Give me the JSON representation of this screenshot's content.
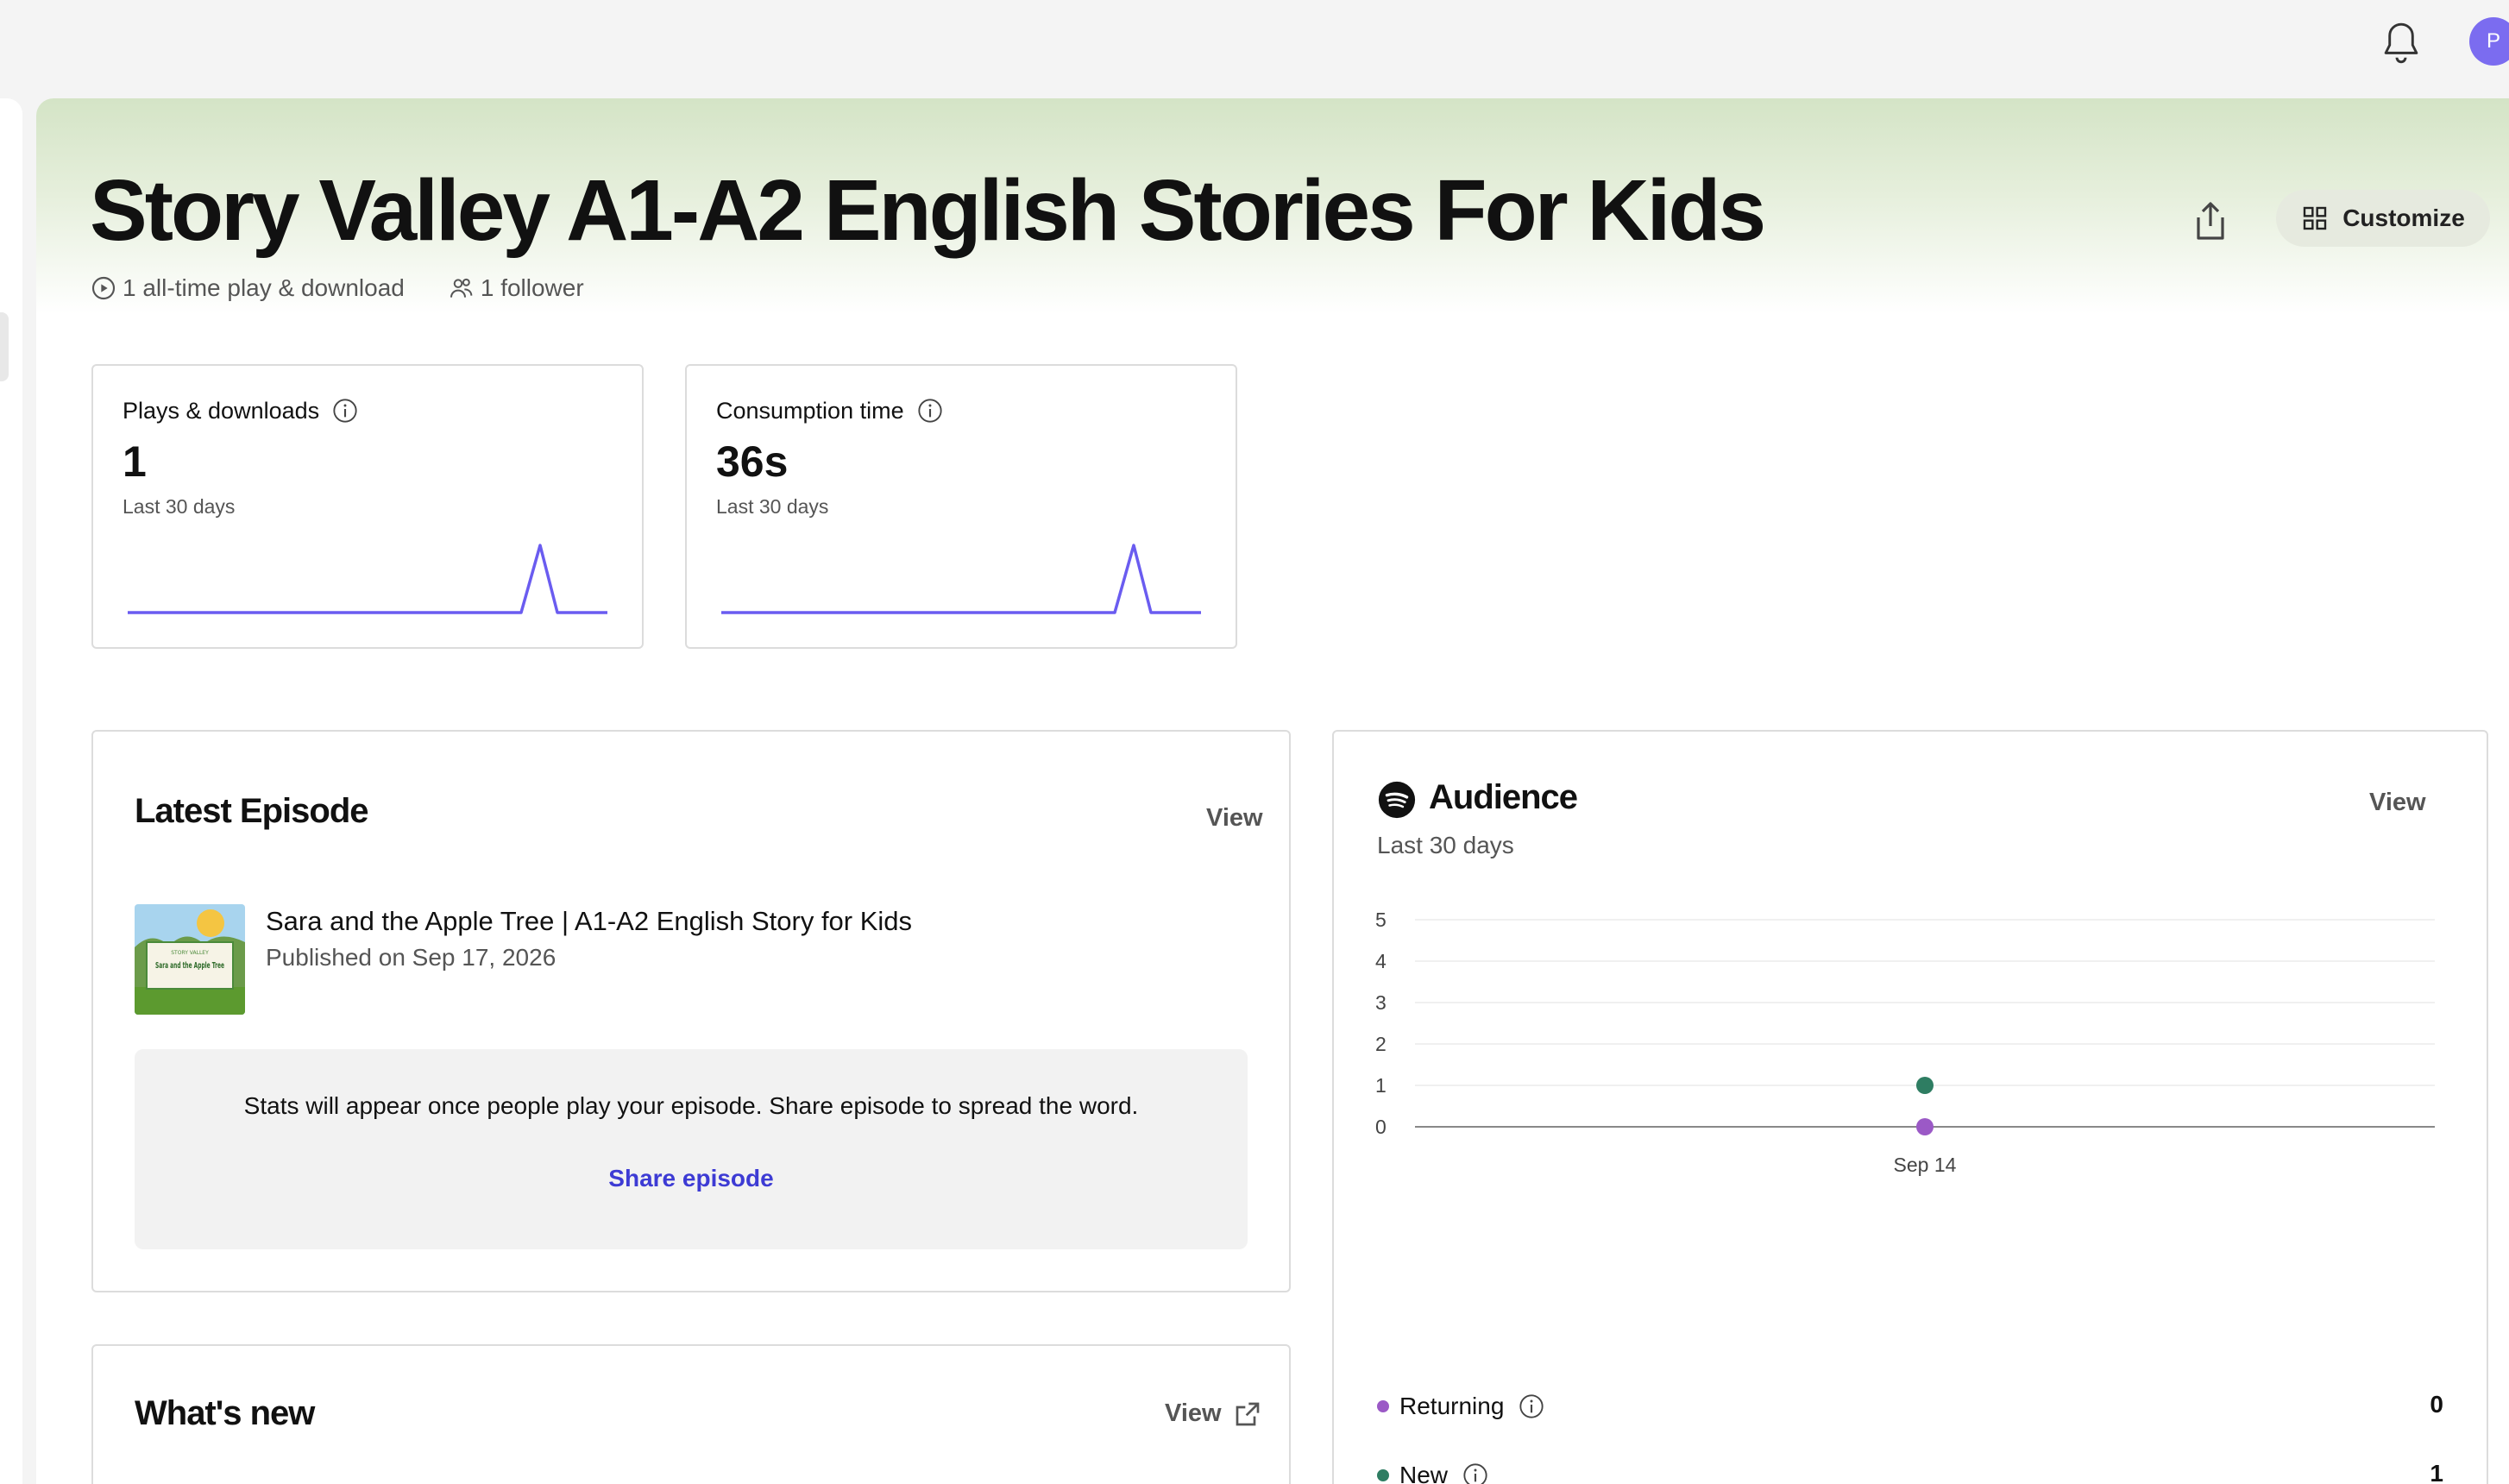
{
  "topbar": {
    "avatar_initial": "P"
  },
  "header": {
    "title": "Story Valley A1-A2 English Stories For Kids",
    "plays_meta": "1 all-time play & download",
    "followers_meta": "1 follower",
    "customize_label": "Customize"
  },
  "stats": [
    {
      "label": "Plays & downloads",
      "value": "1",
      "period": "Last 30 days"
    },
    {
      "label": "Consumption time",
      "value": "36s",
      "period": "Last 30 days"
    }
  ],
  "latest_episode": {
    "heading": "Latest Episode",
    "view_label": "View",
    "episode_title": "Sara and the Apple Tree | A1-A2 English Story for Kids",
    "published": "Published on Sep 17, 2026",
    "thumbnail_text_top": "STORY VALLEY",
    "thumbnail_text_main": "Sara and the Apple Tree",
    "empty_message": "Stats will appear once people play your episode. Share episode to spread the word.",
    "share_label": "Share episode"
  },
  "whats_new": {
    "heading": "What's new",
    "view_label": "View"
  },
  "audience": {
    "heading": "Audience",
    "period": "Last 30 days",
    "view_label": "View",
    "legend": [
      {
        "name": "Returning",
        "value": "0",
        "color": "#9b59c6"
      },
      {
        "name": "New",
        "value": "1",
        "color": "#2e7d62"
      }
    ]
  },
  "chart_data": {
    "type": "scatter",
    "title": "",
    "xlabel": "",
    "ylabel": "",
    "categories": [
      "Sep 14"
    ],
    "ylim": [
      0,
      5
    ],
    "yticks": [
      "0",
      "1",
      "2",
      "3",
      "4",
      "5"
    ],
    "grid": true,
    "series": [
      {
        "name": "Returning",
        "values": [
          0
        ],
        "color": "#9b59c6"
      },
      {
        "name": "New",
        "values": [
          1
        ],
        "color": "#2e7d62"
      }
    ]
  },
  "colors": {
    "accent": "#3d3bd4",
    "sparkline": "#6a5cf0"
  }
}
